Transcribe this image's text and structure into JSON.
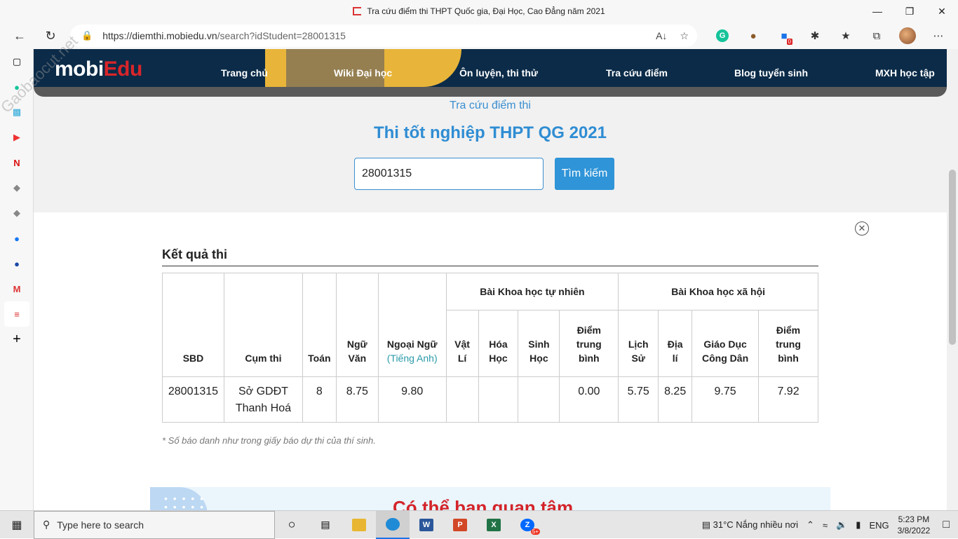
{
  "browser": {
    "tab_title": "Tra cứu điểm thi THPT Quốc gia, Đại Học, Cao Đẳng năm 2021",
    "url_host": "https://diemthi.mobiedu.vn",
    "url_path": "/search?idStudent=28001315",
    "extension_badge": "0"
  },
  "site": {
    "logo_text": "mobi",
    "logo_accent": "Edu",
    "nav": [
      "Trang chủ",
      "Wiki Đại học",
      "Ôn luyện, thi thử",
      "Tra cứu điểm",
      "Blog tuyển sinh",
      "MXH học tập"
    ]
  },
  "search": {
    "breadcrumb": "Tra cứu điểm thi",
    "title": "Thi tốt nghiệp THPT QG 2021",
    "input_value": "28001315",
    "button_label": "Tìm kiếm"
  },
  "results": {
    "heading": "Kết quả thi",
    "headers": {
      "sbd": "SBD",
      "cum_thi": "Cụm thi",
      "toan": "Toán",
      "ngu_van": "Ngữ Văn",
      "ngoai_ngu": "Ngoại Ngữ",
      "ngoai_ngu_sub": "(Tiếng Anh)",
      "khtn": "Bài Khoa học tự nhiên",
      "khxh": "Bài Khoa học xã hội",
      "vat_li": "Vật Lí",
      "hoa_hoc": "Hóa Học",
      "sinh_hoc": "Sinh Học",
      "diem_tb_tn": "Điểm trung bình",
      "lich_su": "Lịch Sử",
      "dia_li": "Địa lí",
      "gdcd": "Giáo Dục Công Dân",
      "diem_tb_xh": "Điểm trung bình"
    },
    "row": {
      "sbd": "28001315",
      "cum_thi": "Sở GDĐT Thanh Hoá",
      "toan": "8",
      "ngu_van": "8.75",
      "ngoai_ngu": "9.80",
      "vat_li": "",
      "hoa_hoc": "",
      "sinh_hoc": "",
      "diem_tb_tn": "0.00",
      "lich_su": "5.75",
      "dia_li": "8.25",
      "gdcd": "9.75",
      "diem_tb_xh": "7.92"
    },
    "note": "* Số báo danh như trong giấy báo dự thi của thí sinh."
  },
  "promo": {
    "title": "Có thể bạn quan tâm"
  },
  "taskbar": {
    "search_placeholder": "Type here to search",
    "weather": "31°C  Nắng nhiều nơi",
    "language": "ENG",
    "time": "5:23 PM",
    "date": "3/8/2022",
    "zalo_badge": "5+"
  },
  "watermark": "Gaobaocut.net"
}
